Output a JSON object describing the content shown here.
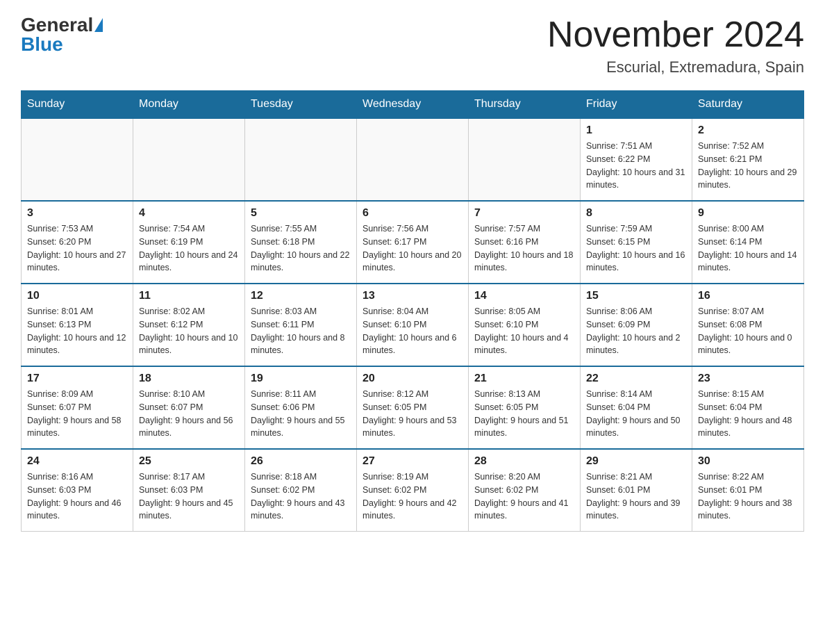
{
  "header": {
    "logo_general": "General",
    "logo_blue": "Blue",
    "month_title": "November 2024",
    "location": "Escurial, Extremadura, Spain"
  },
  "days_of_week": [
    "Sunday",
    "Monday",
    "Tuesday",
    "Wednesday",
    "Thursday",
    "Friday",
    "Saturday"
  ],
  "weeks": [
    [
      {
        "day": "",
        "info": ""
      },
      {
        "day": "",
        "info": ""
      },
      {
        "day": "",
        "info": ""
      },
      {
        "day": "",
        "info": ""
      },
      {
        "day": "",
        "info": ""
      },
      {
        "day": "1",
        "info": "Sunrise: 7:51 AM\nSunset: 6:22 PM\nDaylight: 10 hours and 31 minutes."
      },
      {
        "day": "2",
        "info": "Sunrise: 7:52 AM\nSunset: 6:21 PM\nDaylight: 10 hours and 29 minutes."
      }
    ],
    [
      {
        "day": "3",
        "info": "Sunrise: 7:53 AM\nSunset: 6:20 PM\nDaylight: 10 hours and 27 minutes."
      },
      {
        "day": "4",
        "info": "Sunrise: 7:54 AM\nSunset: 6:19 PM\nDaylight: 10 hours and 24 minutes."
      },
      {
        "day": "5",
        "info": "Sunrise: 7:55 AM\nSunset: 6:18 PM\nDaylight: 10 hours and 22 minutes."
      },
      {
        "day": "6",
        "info": "Sunrise: 7:56 AM\nSunset: 6:17 PM\nDaylight: 10 hours and 20 minutes."
      },
      {
        "day": "7",
        "info": "Sunrise: 7:57 AM\nSunset: 6:16 PM\nDaylight: 10 hours and 18 minutes."
      },
      {
        "day": "8",
        "info": "Sunrise: 7:59 AM\nSunset: 6:15 PM\nDaylight: 10 hours and 16 minutes."
      },
      {
        "day": "9",
        "info": "Sunrise: 8:00 AM\nSunset: 6:14 PM\nDaylight: 10 hours and 14 minutes."
      }
    ],
    [
      {
        "day": "10",
        "info": "Sunrise: 8:01 AM\nSunset: 6:13 PM\nDaylight: 10 hours and 12 minutes."
      },
      {
        "day": "11",
        "info": "Sunrise: 8:02 AM\nSunset: 6:12 PM\nDaylight: 10 hours and 10 minutes."
      },
      {
        "day": "12",
        "info": "Sunrise: 8:03 AM\nSunset: 6:11 PM\nDaylight: 10 hours and 8 minutes."
      },
      {
        "day": "13",
        "info": "Sunrise: 8:04 AM\nSunset: 6:10 PM\nDaylight: 10 hours and 6 minutes."
      },
      {
        "day": "14",
        "info": "Sunrise: 8:05 AM\nSunset: 6:10 PM\nDaylight: 10 hours and 4 minutes."
      },
      {
        "day": "15",
        "info": "Sunrise: 8:06 AM\nSunset: 6:09 PM\nDaylight: 10 hours and 2 minutes."
      },
      {
        "day": "16",
        "info": "Sunrise: 8:07 AM\nSunset: 6:08 PM\nDaylight: 10 hours and 0 minutes."
      }
    ],
    [
      {
        "day": "17",
        "info": "Sunrise: 8:09 AM\nSunset: 6:07 PM\nDaylight: 9 hours and 58 minutes."
      },
      {
        "day": "18",
        "info": "Sunrise: 8:10 AM\nSunset: 6:07 PM\nDaylight: 9 hours and 56 minutes."
      },
      {
        "day": "19",
        "info": "Sunrise: 8:11 AM\nSunset: 6:06 PM\nDaylight: 9 hours and 55 minutes."
      },
      {
        "day": "20",
        "info": "Sunrise: 8:12 AM\nSunset: 6:05 PM\nDaylight: 9 hours and 53 minutes."
      },
      {
        "day": "21",
        "info": "Sunrise: 8:13 AM\nSunset: 6:05 PM\nDaylight: 9 hours and 51 minutes."
      },
      {
        "day": "22",
        "info": "Sunrise: 8:14 AM\nSunset: 6:04 PM\nDaylight: 9 hours and 50 minutes."
      },
      {
        "day": "23",
        "info": "Sunrise: 8:15 AM\nSunset: 6:04 PM\nDaylight: 9 hours and 48 minutes."
      }
    ],
    [
      {
        "day": "24",
        "info": "Sunrise: 8:16 AM\nSunset: 6:03 PM\nDaylight: 9 hours and 46 minutes."
      },
      {
        "day": "25",
        "info": "Sunrise: 8:17 AM\nSunset: 6:03 PM\nDaylight: 9 hours and 45 minutes."
      },
      {
        "day": "26",
        "info": "Sunrise: 8:18 AM\nSunset: 6:02 PM\nDaylight: 9 hours and 43 minutes."
      },
      {
        "day": "27",
        "info": "Sunrise: 8:19 AM\nSunset: 6:02 PM\nDaylight: 9 hours and 42 minutes."
      },
      {
        "day": "28",
        "info": "Sunrise: 8:20 AM\nSunset: 6:02 PM\nDaylight: 9 hours and 41 minutes."
      },
      {
        "day": "29",
        "info": "Sunrise: 8:21 AM\nSunset: 6:01 PM\nDaylight: 9 hours and 39 minutes."
      },
      {
        "day": "30",
        "info": "Sunrise: 8:22 AM\nSunset: 6:01 PM\nDaylight: 9 hours and 38 minutes."
      }
    ]
  ]
}
